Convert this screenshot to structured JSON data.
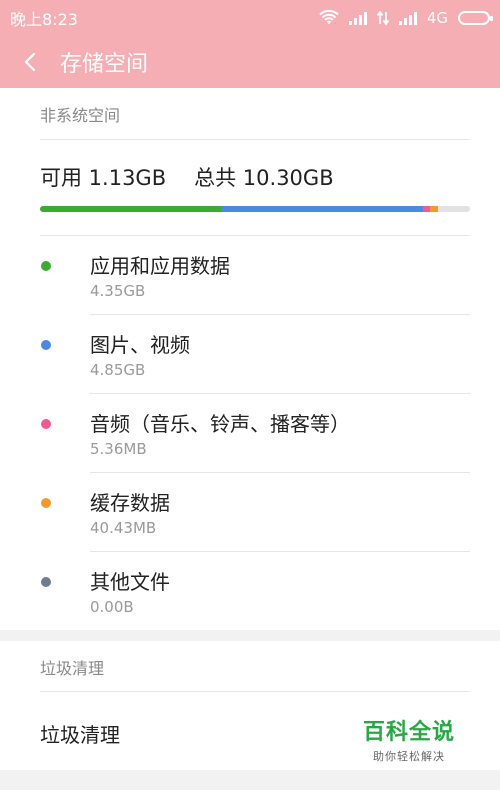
{
  "status": {
    "time": "晚上8:23",
    "network": "4G"
  },
  "appbar": {
    "title": "存储空间"
  },
  "sections": {
    "system": "非系统空间",
    "cleanup": "垃圾清理"
  },
  "usage": {
    "available": "可用 1.13GB",
    "total": "总共 10.30GB"
  },
  "usage_bar": [
    {
      "category": "应用和应用数据",
      "fraction": 0.42,
      "color": "#3bab34"
    },
    {
      "category": "图片、视频",
      "fraction": 0.47,
      "color": "#4a8ae0"
    },
    {
      "category": "音频（音乐、铃声、播客等）",
      "fraction": 0.018,
      "color": "#ef5b93"
    },
    {
      "category": "缓存数据",
      "fraction": 0.018,
      "color": "#f59a2a"
    },
    {
      "category": "其他文件",
      "fraction": 0.0,
      "color": "#6e7c95"
    }
  ],
  "categories": [
    {
      "name": "应用和应用数据",
      "size": "4.35GB",
      "color": "#3bab34"
    },
    {
      "name": "图片、视频",
      "size": "4.85GB",
      "color": "#4a8ae0"
    },
    {
      "name": "音频（音乐、铃声、播客等）",
      "size": "5.36MB",
      "color": "#ef5b93"
    },
    {
      "name": "缓存数据",
      "size": "40.43MB",
      "color": "#f59a2a"
    },
    {
      "name": "其他文件",
      "size": "0.00B",
      "color": "#6e7c95"
    }
  ],
  "cleanup": {
    "label": "垃圾清理"
  },
  "watermark": {
    "main": "百科全说",
    "sub": "助你轻松解决"
  },
  "colors": {
    "header": "#f5aeb3"
  }
}
